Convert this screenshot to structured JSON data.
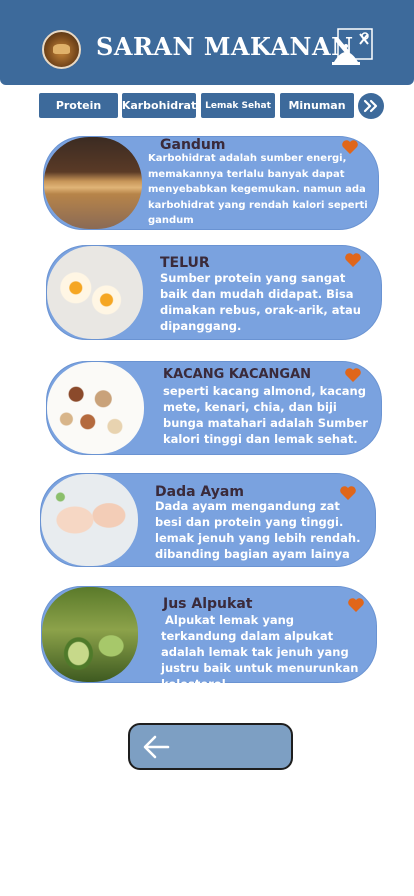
{
  "header": {
    "title": "SARAN MAKANAN",
    "logo_icon": "food-logo-icon",
    "chef_icon": "chef-hat-icon"
  },
  "tabs": [
    {
      "label": "Protein"
    },
    {
      "label": "Karbohidrat"
    },
    {
      "label": "Lemak Sehat"
    },
    {
      "label": "Minuman"
    }
  ],
  "next_icon": "double-chevron-right-icon",
  "foods": [
    {
      "title": "Gandum",
      "description": "Karbohidrat adalah sumber energi, memakannya terlalu banyak dapat menyebabkan kegemukan. namun ada karbohidrat yang rendah kalori seperti gandum",
      "image": "wheat-image"
    },
    {
      "title": "TELUR",
      "description": "Sumber protein yang sangat baik dan mudah didapat. Bisa dimakan rebus, orak-arik, atau dipanggang.",
      "image": "egg-image"
    },
    {
      "title": "KACANG KACANGAN",
      "description": "seperti kacang almond, kacang mete, kenari, chia, dan biji bunga matahari adalah Sumber kalori tinggi dan lemak sehat.",
      "image": "nuts-image"
    },
    {
      "title": "Dada Ayam",
      "description": "Dada ayam mengandung zat besi dan protein yang tinggi. lemak jenuh yang lebih rendah. dibanding bagian ayam lainya",
      "image": "chicken-breast-image"
    },
    {
      "title": "Jus Alpukat",
      "description": " Alpukat lemak yang terkandung dalam alpukat adalah lemak tak jenuh yang justru baik untuk menurunkan kolesterol.",
      "image": "avocado-juice-image"
    }
  ],
  "favorite_icon": "heart-icon",
  "back_icon": "arrow-left-icon",
  "colors": {
    "header": "#3d6a9b",
    "card": "#7aa2df",
    "heart": "#e0661a",
    "back_button": "#7d9fc3"
  }
}
